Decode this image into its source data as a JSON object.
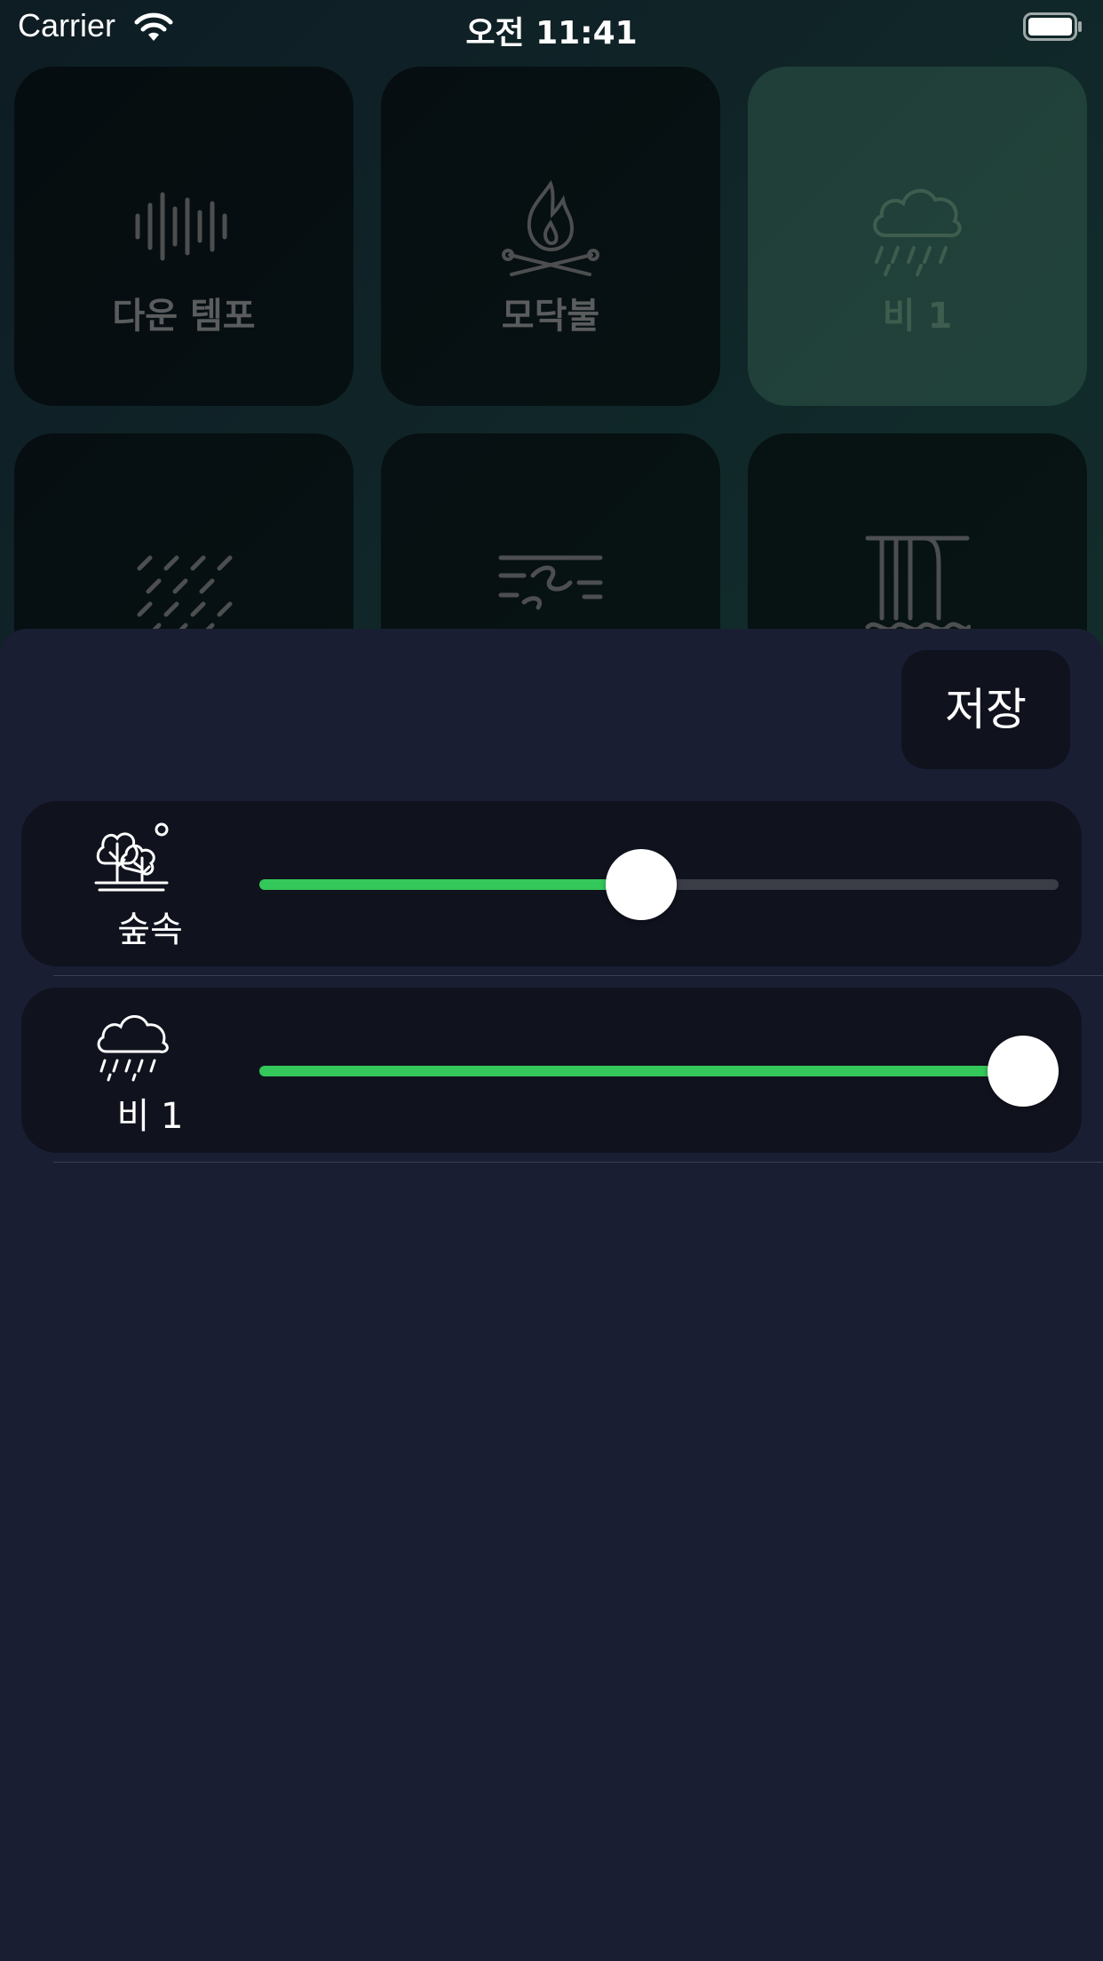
{
  "status_bar": {
    "carrier": "Carrier",
    "time": "오전 11:41",
    "icons": [
      "wifi-icon",
      "battery-icon"
    ]
  },
  "sound_grid": {
    "tiles": [
      {
        "label": "다운 템포",
        "icon": "sound-wave-icon",
        "selected": false
      },
      {
        "label": "모닥불",
        "icon": "campfire-icon",
        "selected": false
      },
      {
        "label": "비 1",
        "icon": "rain-cloud-icon",
        "selected": true
      },
      {
        "label": "",
        "icon": "heavy-rain-icon",
        "selected": false
      },
      {
        "label": "",
        "icon": "wind-icon",
        "selected": false
      },
      {
        "label": "",
        "icon": "waterfall-icon",
        "selected": false
      }
    ]
  },
  "mixer_sheet": {
    "save_label": "저장",
    "accent_color": "#34c759",
    "items": [
      {
        "label": "숲속",
        "icon": "forest-icon",
        "volume": 0.5
      },
      {
        "label": "비 1",
        "icon": "rain-cloud-icon",
        "volume": 1.0
      }
    ]
  }
}
